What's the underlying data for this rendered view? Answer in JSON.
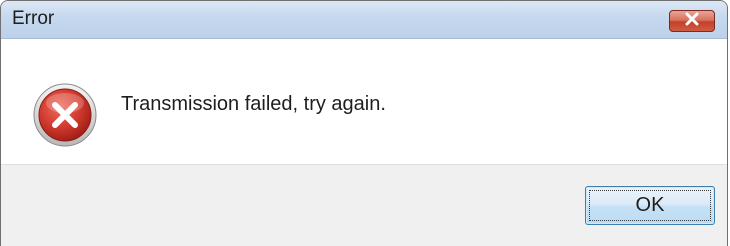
{
  "window": {
    "title": "Error"
  },
  "dialog": {
    "icon": "error-icon",
    "message": "Transmission failed, try again."
  },
  "buttons": {
    "ok_label": "OK",
    "close_icon": "close-icon"
  },
  "colors": {
    "error_red": "#c8322a",
    "close_red": "#c2412a",
    "button_border": "#3c7fb1"
  }
}
